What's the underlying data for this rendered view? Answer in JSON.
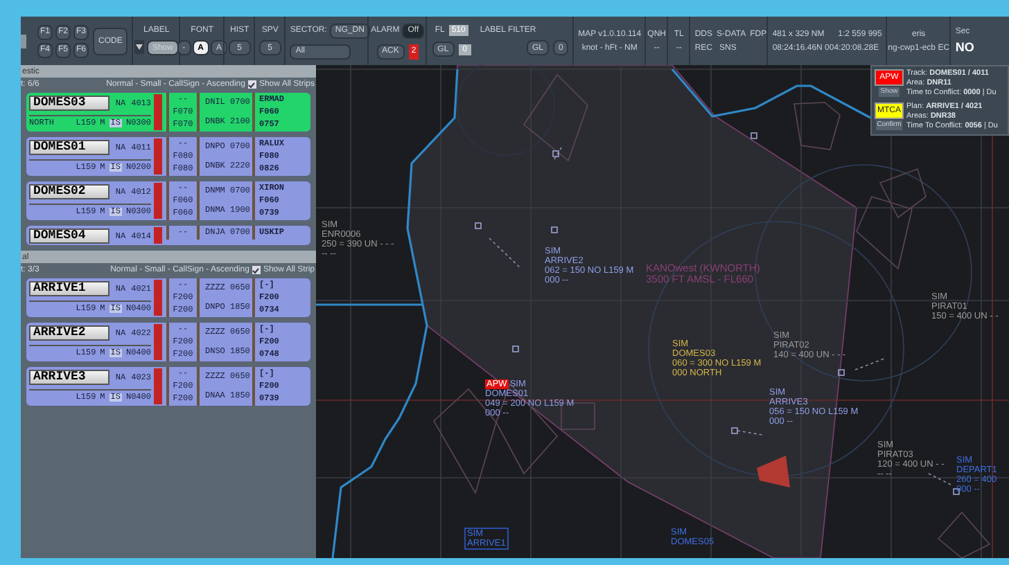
{
  "toolbar": {
    "f_keys": [
      "F1",
      "F2",
      "F3",
      "F4",
      "F5",
      "F6"
    ],
    "code_button": "CODE",
    "label": {
      "title": "LABEL",
      "show": "Show"
    },
    "font": {
      "title": "FONT",
      "minus": "-",
      "buttons": [
        "A",
        "A"
      ]
    },
    "hist": {
      "title": "HIST",
      "value": "5"
    },
    "spv": {
      "title": "SPV",
      "value": "5"
    },
    "sector": {
      "title": "SECTOR:",
      "badge": "NG_DN",
      "value": "All"
    },
    "alarm": {
      "title": "ALARM",
      "toggle": "Off",
      "ack": "ACK",
      "count": "2"
    },
    "fl": {
      "title": "FL",
      "value": "510",
      "gl": "GL",
      "gl_value": "0"
    },
    "label_filter": {
      "title": "LABEL FILTER",
      "buttons": [
        "GL",
        "0"
      ]
    },
    "map": {
      "version": "MAP v1.0.10.114",
      "units": "knot - hFt - NM"
    },
    "qnh": {
      "title": "QNH",
      "value": "--"
    },
    "tl": {
      "title": "TL",
      "value": "--"
    },
    "data_status": [
      "DDS",
      "S-DATA",
      "FDP"
    ],
    "data_status_2": [
      "REC",
      "SNS"
    ],
    "scale": {
      "extent": "481 x 329 NM",
      "ratio": "1:2 559 995",
      "position": "08:24:16.46N 004:20:08.28E"
    },
    "user": {
      "name": "eris",
      "station": "ng-cwp1-ecb EC"
    },
    "sector_status": {
      "title": "Sec",
      "value": "NO"
    }
  },
  "strip_sections": [
    {
      "title": "estic",
      "count": "t: 6/6",
      "sort": "Normal - Small - CallSign - Ascending",
      "show_all": {
        "label": "Show All Strips",
        "checked": true
      },
      "strips": [
        {
          "callsign": "DOMES03",
          "selected": true,
          "na": "NA",
          "code": "4013",
          "remark": "NORTH",
          "rfl": "L159",
          "m": "M",
          "is": "IS",
          "speed": "N0300",
          "col1": [
            "--",
            "F070",
            "F070"
          ],
          "col2": [
            "DNIL 0700",
            "DNBK 2100"
          ],
          "col3": [
            "ERMAD",
            "F060",
            "0757"
          ]
        },
        {
          "callsign": "DOMES01",
          "selected": false,
          "na": "NA",
          "code": "4011",
          "rfl": "L159",
          "m": "M",
          "is": "IS",
          "speed": "N0200",
          "col1": [
            "--",
            "F080",
            "F080"
          ],
          "col2": [
            "DNPO 0700",
            "DNBK 2220"
          ],
          "col3": [
            "RALUX",
            "F080",
            "0826"
          ]
        },
        {
          "callsign": "DOMES02",
          "selected": false,
          "na": "NA",
          "code": "4012",
          "rfl": "L159",
          "m": "M",
          "is": "IS",
          "speed": "N0300",
          "col1": [
            "--",
            "F060",
            "F060"
          ],
          "col2": [
            "DNMM 0700",
            "DNMA 1900"
          ],
          "col3": [
            "XIRON",
            "F060",
            "0739"
          ]
        },
        {
          "callsign": "DOMES04",
          "selected": false,
          "na": "NA",
          "code": "4014",
          "col1": [
            "--"
          ],
          "col2": [
            "DNJA 0700"
          ],
          "col3": [
            "USKIP"
          ]
        }
      ]
    },
    {
      "title": "al",
      "count": "t: 3/3",
      "sort": "Normal - Small - CallSign - Ascending",
      "show_all": {
        "label": "Show All Strip",
        "checked": true
      },
      "strips": [
        {
          "callsign": "ARRIVE1",
          "selected": false,
          "na": "NA",
          "code": "4021",
          "rfl": "L159",
          "m": "M",
          "is": "IS",
          "speed": "N0400",
          "col1": [
            "--",
            "F200",
            "F200"
          ],
          "col2": [
            "ZZZZ 0650",
            "DNPO 1850"
          ],
          "col3": [
            "[-]",
            "F200",
            "0734"
          ]
        },
        {
          "callsign": "ARRIVE2",
          "selected": false,
          "na": "NA",
          "code": "4022",
          "rfl": "L159",
          "m": "M",
          "is": "IS",
          "speed": "N0400",
          "col1": [
            "--",
            "F200",
            "F200"
          ],
          "col2": [
            "ZZZZ 0650",
            "DNSO 1850"
          ],
          "col3": [
            "[-]",
            "F200",
            "0748"
          ]
        },
        {
          "callsign": "ARRIVE3",
          "selected": false,
          "na": "NA",
          "code": "4023",
          "rfl": "L159",
          "m": "M",
          "is": "IS",
          "speed": "N0400",
          "col1": [
            "--",
            "F200",
            "F200"
          ],
          "col2": [
            "ZZZZ 0650",
            "DNAA 1850"
          ],
          "col3": [
            "[-]",
            "F200",
            "0739"
          ]
        }
      ]
    }
  ],
  "alerts": [
    {
      "kind": "apw",
      "label": "APW",
      "color": "#ff0000",
      "action": "Show",
      "lines": [
        "Track: **DOMES01 / 4011**",
        "Area: **DNR11**",
        "Time to Conflict: **0000** | Du"
      ]
    },
    {
      "kind": "mtca",
      "label": "MTCA",
      "color": "#ffff00",
      "action": "Confirm",
      "lines": [
        "Plan: **ARRIVE1 / 4021**",
        "Areas: **DNR38**",
        "Time To Conflict: **0056** | Du"
      ]
    }
  ],
  "map_labels": [
    {
      "kind": "track",
      "color": "#9a9a9a",
      "lines": [
        "SIM",
        "ENR0006",
        "250 = 390 UN - - -",
        "-- --"
      ]
    },
    {
      "kind": "track",
      "color": "#8f9fe8",
      "lines": [
        "SIM",
        "ARRIVE2",
        "062 = 150 NO L159 M",
        "000 --"
      ]
    },
    {
      "kind": "area",
      "color": "#8a3f78",
      "lines": [
        "KANOwest (KWNORTH)",
        "3500 FT AMSL - FL660"
      ]
    },
    {
      "kind": "track",
      "color": "#9a9a9a",
      "lines": [
        "SIM",
        "PIRAT01",
        "150 = 400 UN - -"
      ]
    },
    {
      "kind": "track",
      "color": "#d4b64a",
      "lines": [
        "SIM",
        "DOMES03",
        "060 = 300 NO L159 M",
        "000 NORTH"
      ]
    },
    {
      "kind": "track",
      "color": "#9a9a9a",
      "lines": [
        "SIM",
        "PIRAT02",
        "140 = 400 UN - - -"
      ]
    },
    {
      "kind": "track",
      "color": "#8f9fe8",
      "alert": "APW",
      "lines": [
        "SIM",
        "DOMES01",
        "049 = 200 NO L159 M",
        "000 --"
      ]
    },
    {
      "kind": "track",
      "color": "#8f9fe8",
      "lines": [
        "SIM",
        "ARRIVE3",
        "056 = 150 NO L159 M",
        "000 --"
      ]
    },
    {
      "kind": "track",
      "color": "#9a9a9a",
      "lines": [
        "SIM",
        "PIRAT03",
        "120 = 400 UN - -",
        "-- --"
      ]
    },
    {
      "kind": "track",
      "color": "#3f6fe0",
      "lines": [
        "SIM",
        "DEPART1",
        "260 = 400",
        "000 --"
      ]
    },
    {
      "kind": "track",
      "color": "#3f6fe0",
      "boxed": true,
      "lines": [
        "SIM",
        "ARRIVE1"
      ]
    },
    {
      "kind": "track",
      "color": "#3f6fe0",
      "lines": [
        "SIM",
        "DOMES05"
      ]
    }
  ]
}
